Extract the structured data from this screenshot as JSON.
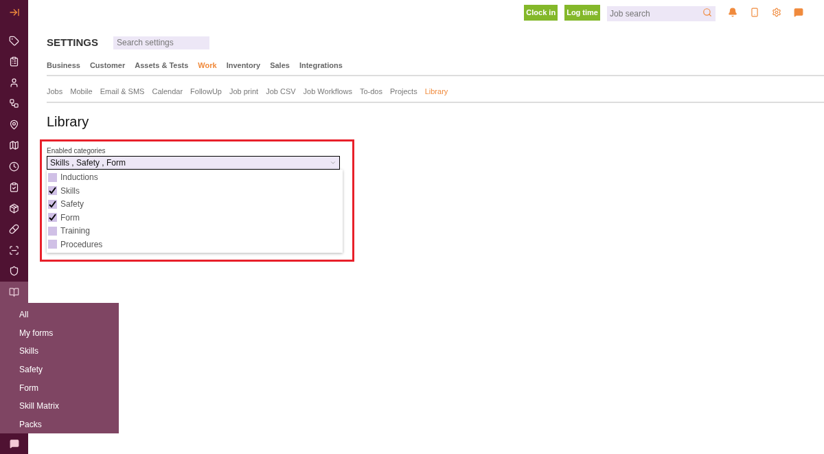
{
  "sidebar": {
    "items": [
      {
        "selected": false
      },
      {
        "selected": false
      },
      {
        "selected": false
      },
      {
        "selected": false
      },
      {
        "selected": false
      },
      {
        "selected": false
      },
      {
        "selected": false
      },
      {
        "selected": false
      },
      {
        "selected": false
      },
      {
        "selected": false
      },
      {
        "selected": false
      },
      {
        "selected": false
      },
      {
        "selected": true
      }
    ]
  },
  "flyout_menu": {
    "items": [
      "All",
      "My forms",
      "Skills",
      "Safety",
      "Form",
      "Skill Matrix",
      "Packs"
    ]
  },
  "top_bar": {
    "buttons": [
      "Clock in",
      "Log time"
    ],
    "search": {
      "placeholder": "Job search"
    }
  },
  "header": {
    "title": "SETTINGS",
    "search": {
      "placeholder": "Search settings"
    }
  },
  "tabs": [
    {
      "label": "Business",
      "selected": false
    },
    {
      "label": "Customer",
      "selected": false
    },
    {
      "label": "Assets & Tests",
      "selected": false
    },
    {
      "label": "Work",
      "selected": true
    },
    {
      "label": "Inventory",
      "selected": false
    },
    {
      "label": "Sales",
      "selected": false
    },
    {
      "label": "Integrations",
      "selected": false
    }
  ],
  "subtabs": [
    {
      "label": "Jobs",
      "selected": false
    },
    {
      "label": "Mobile",
      "selected": false
    },
    {
      "label": "Email & SMS",
      "selected": false
    },
    {
      "label": "Calendar",
      "selected": false
    },
    {
      "label": "FollowUp",
      "selected": false
    },
    {
      "label": "Job print",
      "selected": false
    },
    {
      "label": "Job CSV",
      "selected": false
    },
    {
      "label": "Job Workflows",
      "selected": false
    },
    {
      "label": "To-dos",
      "selected": false
    },
    {
      "label": "Projects",
      "selected": false
    },
    {
      "label": "Library",
      "selected": true
    }
  ],
  "page_title": "Library",
  "categories": {
    "label": "Enabled categories",
    "value": "Skills , Safety , Form",
    "options": [
      {
        "label": "Inductions",
        "checked": false
      },
      {
        "label": "Skills",
        "checked": true
      },
      {
        "label": "Safety",
        "checked": true
      },
      {
        "label": "Form",
        "checked": true
      },
      {
        "label": "Training",
        "checked": false
      },
      {
        "label": "Procedures",
        "checked": false
      }
    ]
  }
}
